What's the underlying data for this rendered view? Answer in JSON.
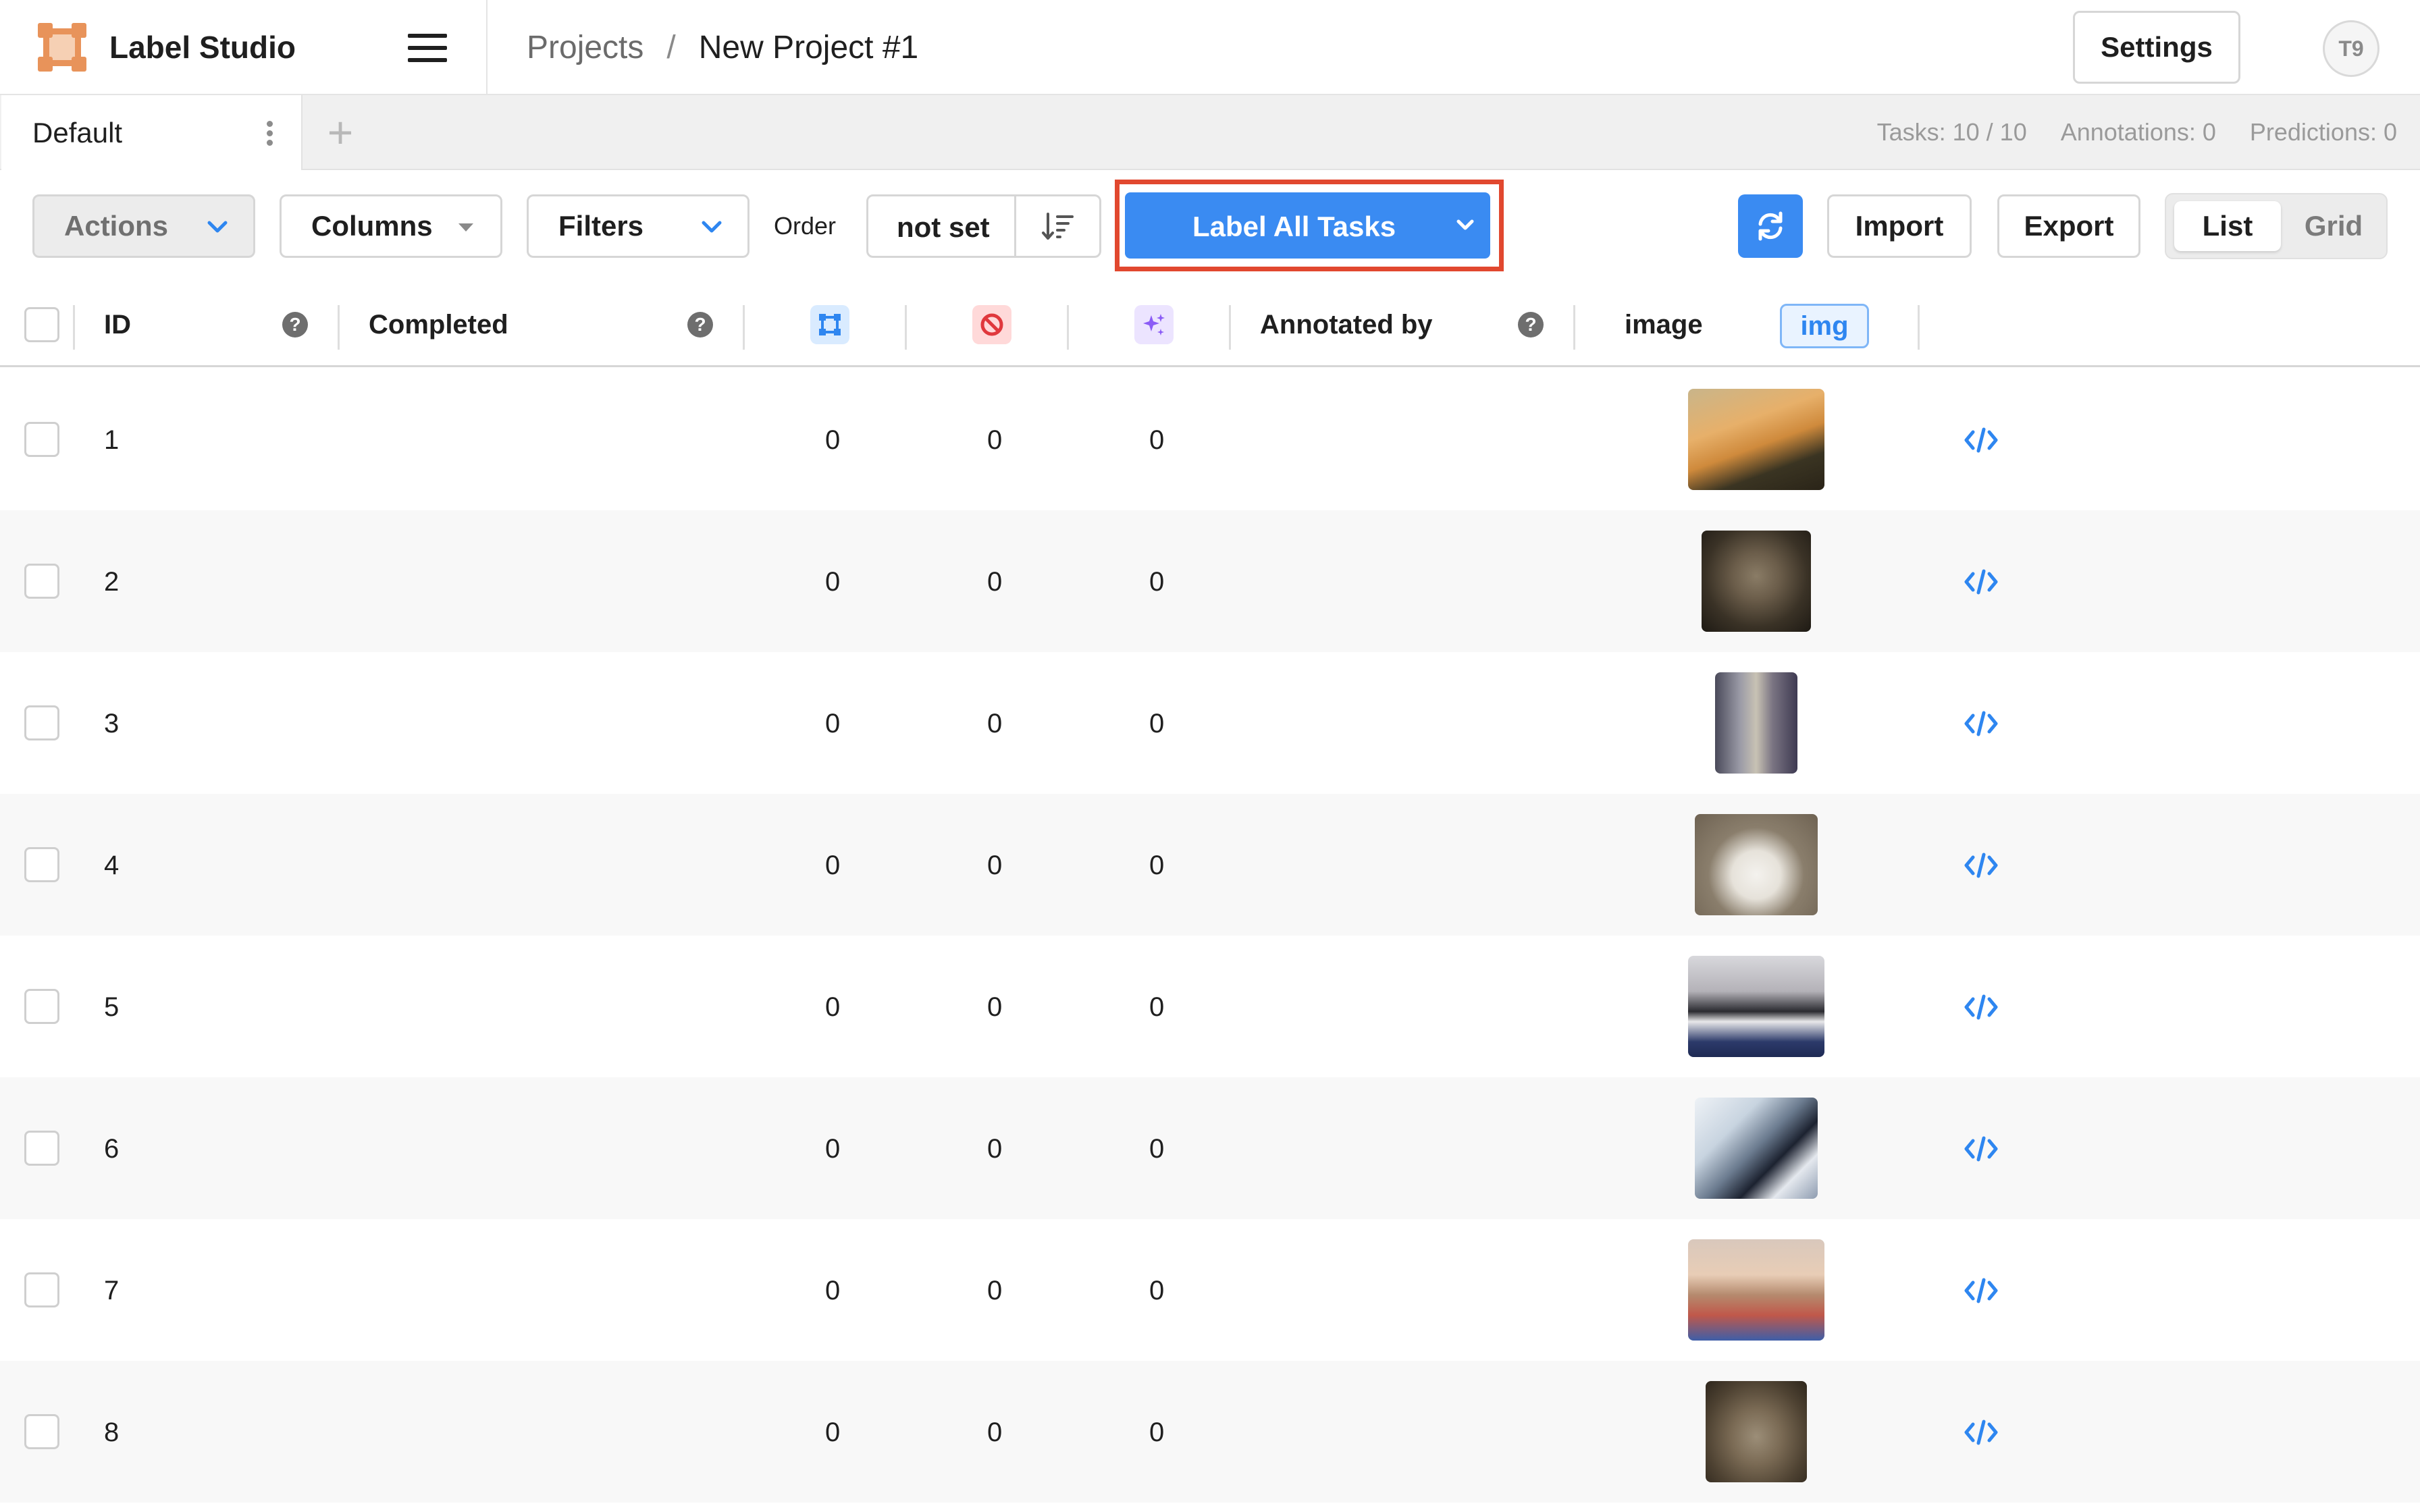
{
  "header": {
    "app_name": "Label Studio",
    "breadcrumb": {
      "root": "Projects",
      "separator": "/",
      "current": "New Project #1"
    },
    "settings_label": "Settings",
    "avatar_initials": "T9"
  },
  "tabs": {
    "items": [
      {
        "label": "Default"
      }
    ],
    "add_label": "+",
    "stats": {
      "tasks": "Tasks: 10 / 10",
      "annotations": "Annotations: 0",
      "predictions": "Predictions: 0"
    }
  },
  "toolbar": {
    "actions_label": "Actions",
    "columns_label": "Columns",
    "filters_label": "Filters",
    "order_label": "Order",
    "order_value": "not set",
    "label_all_label": "Label All Tasks",
    "import_label": "Import",
    "export_label": "Export",
    "view": {
      "list_label": "List",
      "grid_label": "Grid",
      "selected": "List"
    },
    "highlight_color": "#e1482f",
    "primary_color": "#3a8bf2"
  },
  "table": {
    "columns": {
      "id": "ID",
      "completed": "Completed",
      "total_annotations_icon": "annotations-icon",
      "cancelled_icon": "cancelled-icon",
      "predictions_icon": "predictions-icon",
      "annotated_by": "Annotated by",
      "image": "image",
      "image_type": "img",
      "help_glyph": "?"
    },
    "rows": [
      {
        "id": "1",
        "annotations": "0",
        "cancelled": "0",
        "predictions": "0",
        "thumb": "cat-orange"
      },
      {
        "id": "2",
        "annotations": "0",
        "cancelled": "0",
        "predictions": "0",
        "thumb": "cat-tabby"
      },
      {
        "id": "3",
        "annotations": "0",
        "cancelled": "0",
        "predictions": "0",
        "thumb": "cat-cage"
      },
      {
        "id": "4",
        "annotations": "0",
        "cancelled": "0",
        "predictions": "0",
        "thumb": "cat-white"
      },
      {
        "id": "5",
        "annotations": "0",
        "cancelled": "0",
        "predictions": "0",
        "thumb": "cat-black-white"
      },
      {
        "id": "6",
        "annotations": "0",
        "cancelled": "0",
        "predictions": "0",
        "thumb": "cat-window"
      },
      {
        "id": "7",
        "annotations": "0",
        "cancelled": "0",
        "predictions": "0",
        "thumb": "child-cat"
      },
      {
        "id": "8",
        "annotations": "0",
        "cancelled": "0",
        "predictions": "0",
        "thumb": "cat-kitten"
      }
    ]
  }
}
